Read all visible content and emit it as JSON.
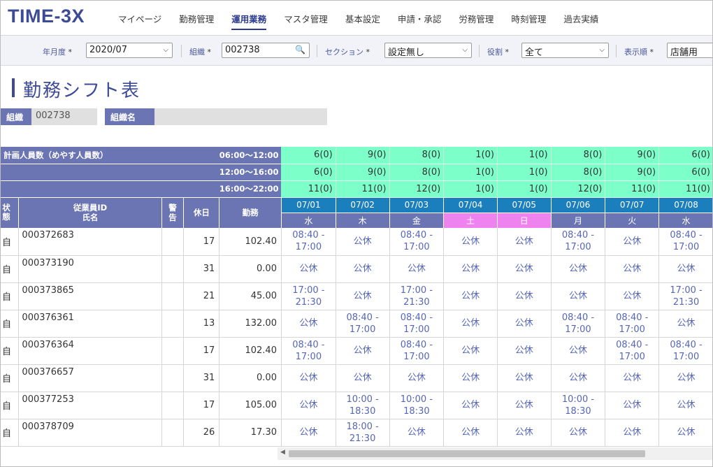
{
  "app": {
    "logo": "TIME-3X"
  },
  "nav": [
    {
      "label": "マイページ",
      "active": false
    },
    {
      "label": "勤務管理",
      "active": false
    },
    {
      "label": "運用業務",
      "active": true
    },
    {
      "label": "マスタ管理",
      "active": false
    },
    {
      "label": "基本設定",
      "active": false
    },
    {
      "label": "申請・承認",
      "active": false
    },
    {
      "label": "労務管理",
      "active": false
    },
    {
      "label": "時刻管理",
      "active": false
    },
    {
      "label": "過去実績",
      "active": false
    }
  ],
  "filters": {
    "year_month": {
      "label": "年月度",
      "req": "*",
      "value": "2020/07"
    },
    "org": {
      "label": "組織",
      "req": "*",
      "value": "002738"
    },
    "section": {
      "label": "セクション",
      "req": "*",
      "value": "設定無し"
    },
    "role": {
      "label": "役割",
      "req": "*",
      "value": "全て"
    },
    "order": {
      "label": "表示順",
      "req": "*",
      "value": "店舗用"
    }
  },
  "page": {
    "title": "勤務シフト表",
    "org_label": "組織",
    "org_code": "002738",
    "org_name_label": "組織名",
    "org_name": ""
  },
  "plan": {
    "label": "計画人員数（めやす人員数）",
    "rows": [
      {
        "time": "06:00～12:00",
        "values": [
          "6(0)",
          "9(0)",
          "8(0)",
          "1(0)",
          "1(0)",
          "8(0)",
          "9(0)",
          "6(0)"
        ]
      },
      {
        "time": "12:00～16:00",
        "values": [
          "6(0)",
          "9(0)",
          "8(0)",
          "1(0)",
          "1(0)",
          "8(0)",
          "9(0)",
          "6(0)"
        ]
      },
      {
        "time": "16:00～22:00",
        "values": [
          "11(0)",
          "11(0)",
          "12(0)",
          "1(0)",
          "1(0)",
          "12(0)",
          "11(0)",
          "11(0)"
        ]
      }
    ]
  },
  "columns": {
    "status": "状態",
    "emp_id": "従業員ID",
    "emp_name": "氏名",
    "warning": "警告",
    "holidays": "休日",
    "work": "勤務"
  },
  "dates": [
    {
      "date": "07/01",
      "dow": "水",
      "holiday": false
    },
    {
      "date": "07/02",
      "dow": "木",
      "holiday": false
    },
    {
      "date": "07/03",
      "dow": "金",
      "holiday": false
    },
    {
      "date": "07/04",
      "dow": "土",
      "holiday": true
    },
    {
      "date": "07/05",
      "dow": "日",
      "holiday": true
    },
    {
      "date": "07/06",
      "dow": "月",
      "holiday": false
    },
    {
      "date": "07/07",
      "dow": "火",
      "holiday": false
    },
    {
      "date": "07/08",
      "dow": "水",
      "holiday": false
    }
  ],
  "employees": [
    {
      "status": "自",
      "id": "000372683",
      "warning": "",
      "holidays": "17",
      "work": "102.40",
      "shifts": [
        "08:40 -|17:00",
        "公休",
        "08:40 -|17:00",
        "公休",
        "公休",
        "08:40 -|17:00",
        "公休",
        "08:40 -|17:00"
      ]
    },
    {
      "status": "自",
      "id": "000373190",
      "warning": "",
      "holidays": "31",
      "work": "0.00",
      "shifts": [
        "公休",
        "公休",
        "公休",
        "公休",
        "公休",
        "公休",
        "公休",
        "公休"
      ]
    },
    {
      "status": "自",
      "id": "000373865",
      "warning": "",
      "holidays": "21",
      "work": "45.00",
      "shifts": [
        "17:00 -|21:30",
        "公休",
        "17:00 -|21:30",
        "公休",
        "公休",
        "公休",
        "公休",
        "17:00 -|21:30"
      ]
    },
    {
      "status": "自",
      "id": "000376361",
      "warning": "",
      "holidays": "13",
      "work": "132.00",
      "shifts": [
        "公休",
        "08:40 -|17:00",
        "08:40 -|17:00",
        "公休",
        "公休",
        "08:40 -|17:00",
        "08:40 -|17:00",
        "公休"
      ]
    },
    {
      "status": "自",
      "id": "000376364",
      "warning": "",
      "holidays": "17",
      "work": "102.40",
      "shifts": [
        "08:40 -|17:00",
        "公休",
        "08:40 -|17:00",
        "公休",
        "公休",
        "公休",
        "08:40 -|17:00",
        "08:40 -|17:00"
      ]
    },
    {
      "status": "自",
      "id": "000376657",
      "warning": "",
      "holidays": "31",
      "work": "0.00",
      "shifts": [
        "公休",
        "公休",
        "公休",
        "公休",
        "公休",
        "公休",
        "公休",
        "公休"
      ]
    },
    {
      "status": "自",
      "id": "000377253",
      "warning": "",
      "holidays": "17",
      "work": "105.00",
      "shifts": [
        "公休",
        "10:00 -|18:30",
        "10:00 -|18:30",
        "公休",
        "公休",
        "10:00 -|18:30",
        "公休",
        "公休"
      ]
    },
    {
      "status": "自",
      "id": "000378709",
      "warning": "",
      "holidays": "26",
      "work": "17.30",
      "shifts": [
        "公休",
        "18:00 -|21:30",
        "公休",
        "公休",
        "公休",
        "公休",
        "公休",
        "公休"
      ]
    }
  ],
  "colors": {
    "brand": "#3d4a96",
    "header": "#6b75b3",
    "date_header": "#1b7fbd",
    "holiday": "#ee82ee",
    "plan_cell": "#7dffca",
    "shift_text": "#5666b8"
  }
}
